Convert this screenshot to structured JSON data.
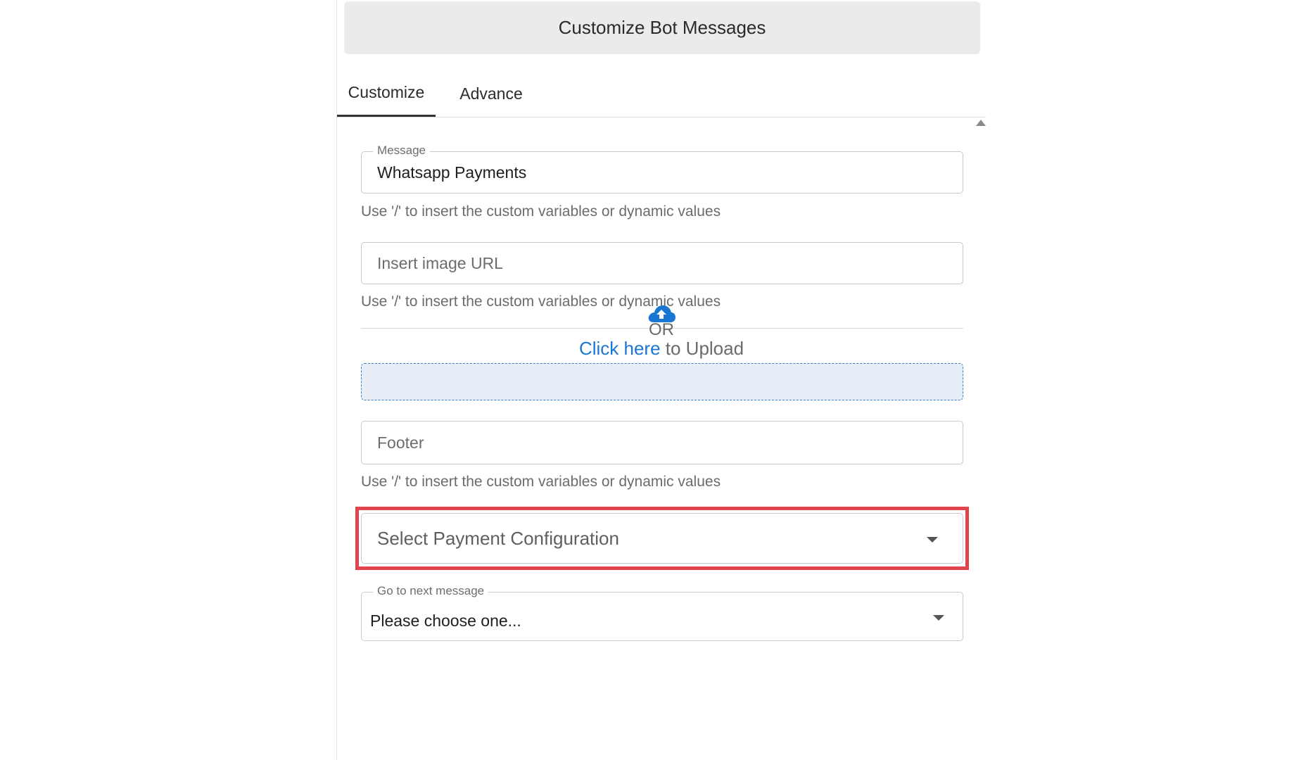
{
  "header": {
    "title": "Customize Bot Messages"
  },
  "tabs": [
    {
      "label": "Customize",
      "active": true
    },
    {
      "label": "Advance",
      "active": false
    }
  ],
  "message_field": {
    "label": "Message",
    "value": "Whatsapp Payments",
    "helper": "Use '/' to insert the custom variables or dynamic values"
  },
  "image_url_field": {
    "placeholder": "Insert image URL",
    "helper": "Use '/' to insert the custom variables or dynamic values"
  },
  "upload": {
    "or_text": "OR",
    "link_text": "Click here",
    "suffix_text": " to Upload"
  },
  "footer_field": {
    "placeholder": "Footer",
    "helper": "Use '/' to insert the custom variables or dynamic values"
  },
  "payment_select": {
    "placeholder": "Select Payment Configuration"
  },
  "next_message_select": {
    "label": "Go to next message",
    "value": "Please choose one..."
  },
  "colors": {
    "link": "#1976d2",
    "highlight": "#e0454f",
    "dropzone_bg": "#e8eef8",
    "header_bg": "#ebebee"
  }
}
